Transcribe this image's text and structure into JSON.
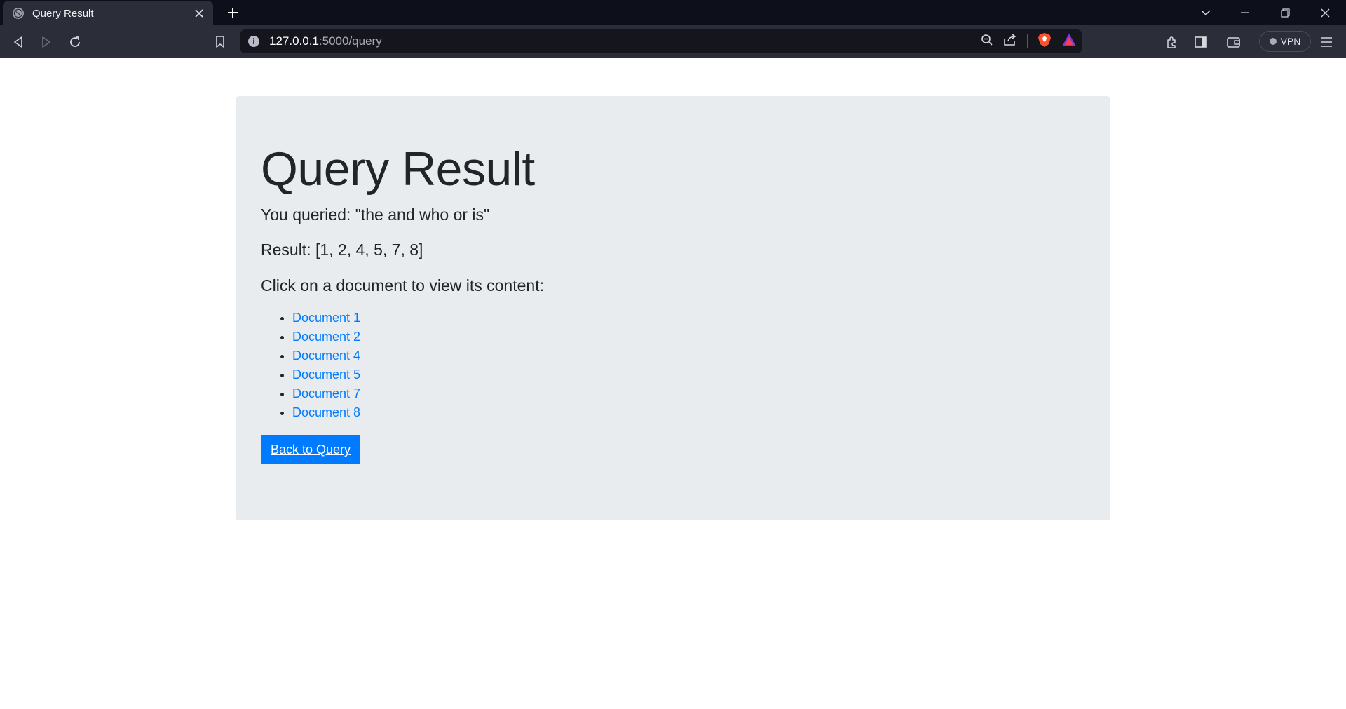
{
  "browser": {
    "tab": {
      "title": "Query Result"
    },
    "url": {
      "host": "127.0.0.1",
      "path": ":5000/query"
    },
    "vpn_label": "VPN"
  },
  "page": {
    "title": "Query Result",
    "queried_text": "You queried: \"the and who or is\"",
    "result_text": "Result: [1, 2, 4, 5, 7, 8]",
    "instruction": "Click on a document to view its content:",
    "documents": [
      "Document 1",
      "Document 2",
      "Document 4",
      "Document 5",
      "Document 7",
      "Document 8"
    ],
    "back_button": "Back to Query"
  },
  "colors": {
    "link": "#007bff",
    "button": "#007bff",
    "jumbotron_bg": "#e9ecef",
    "tabstrip_bg": "#0d0f1a",
    "toolbar_bg": "#2b2d39"
  }
}
